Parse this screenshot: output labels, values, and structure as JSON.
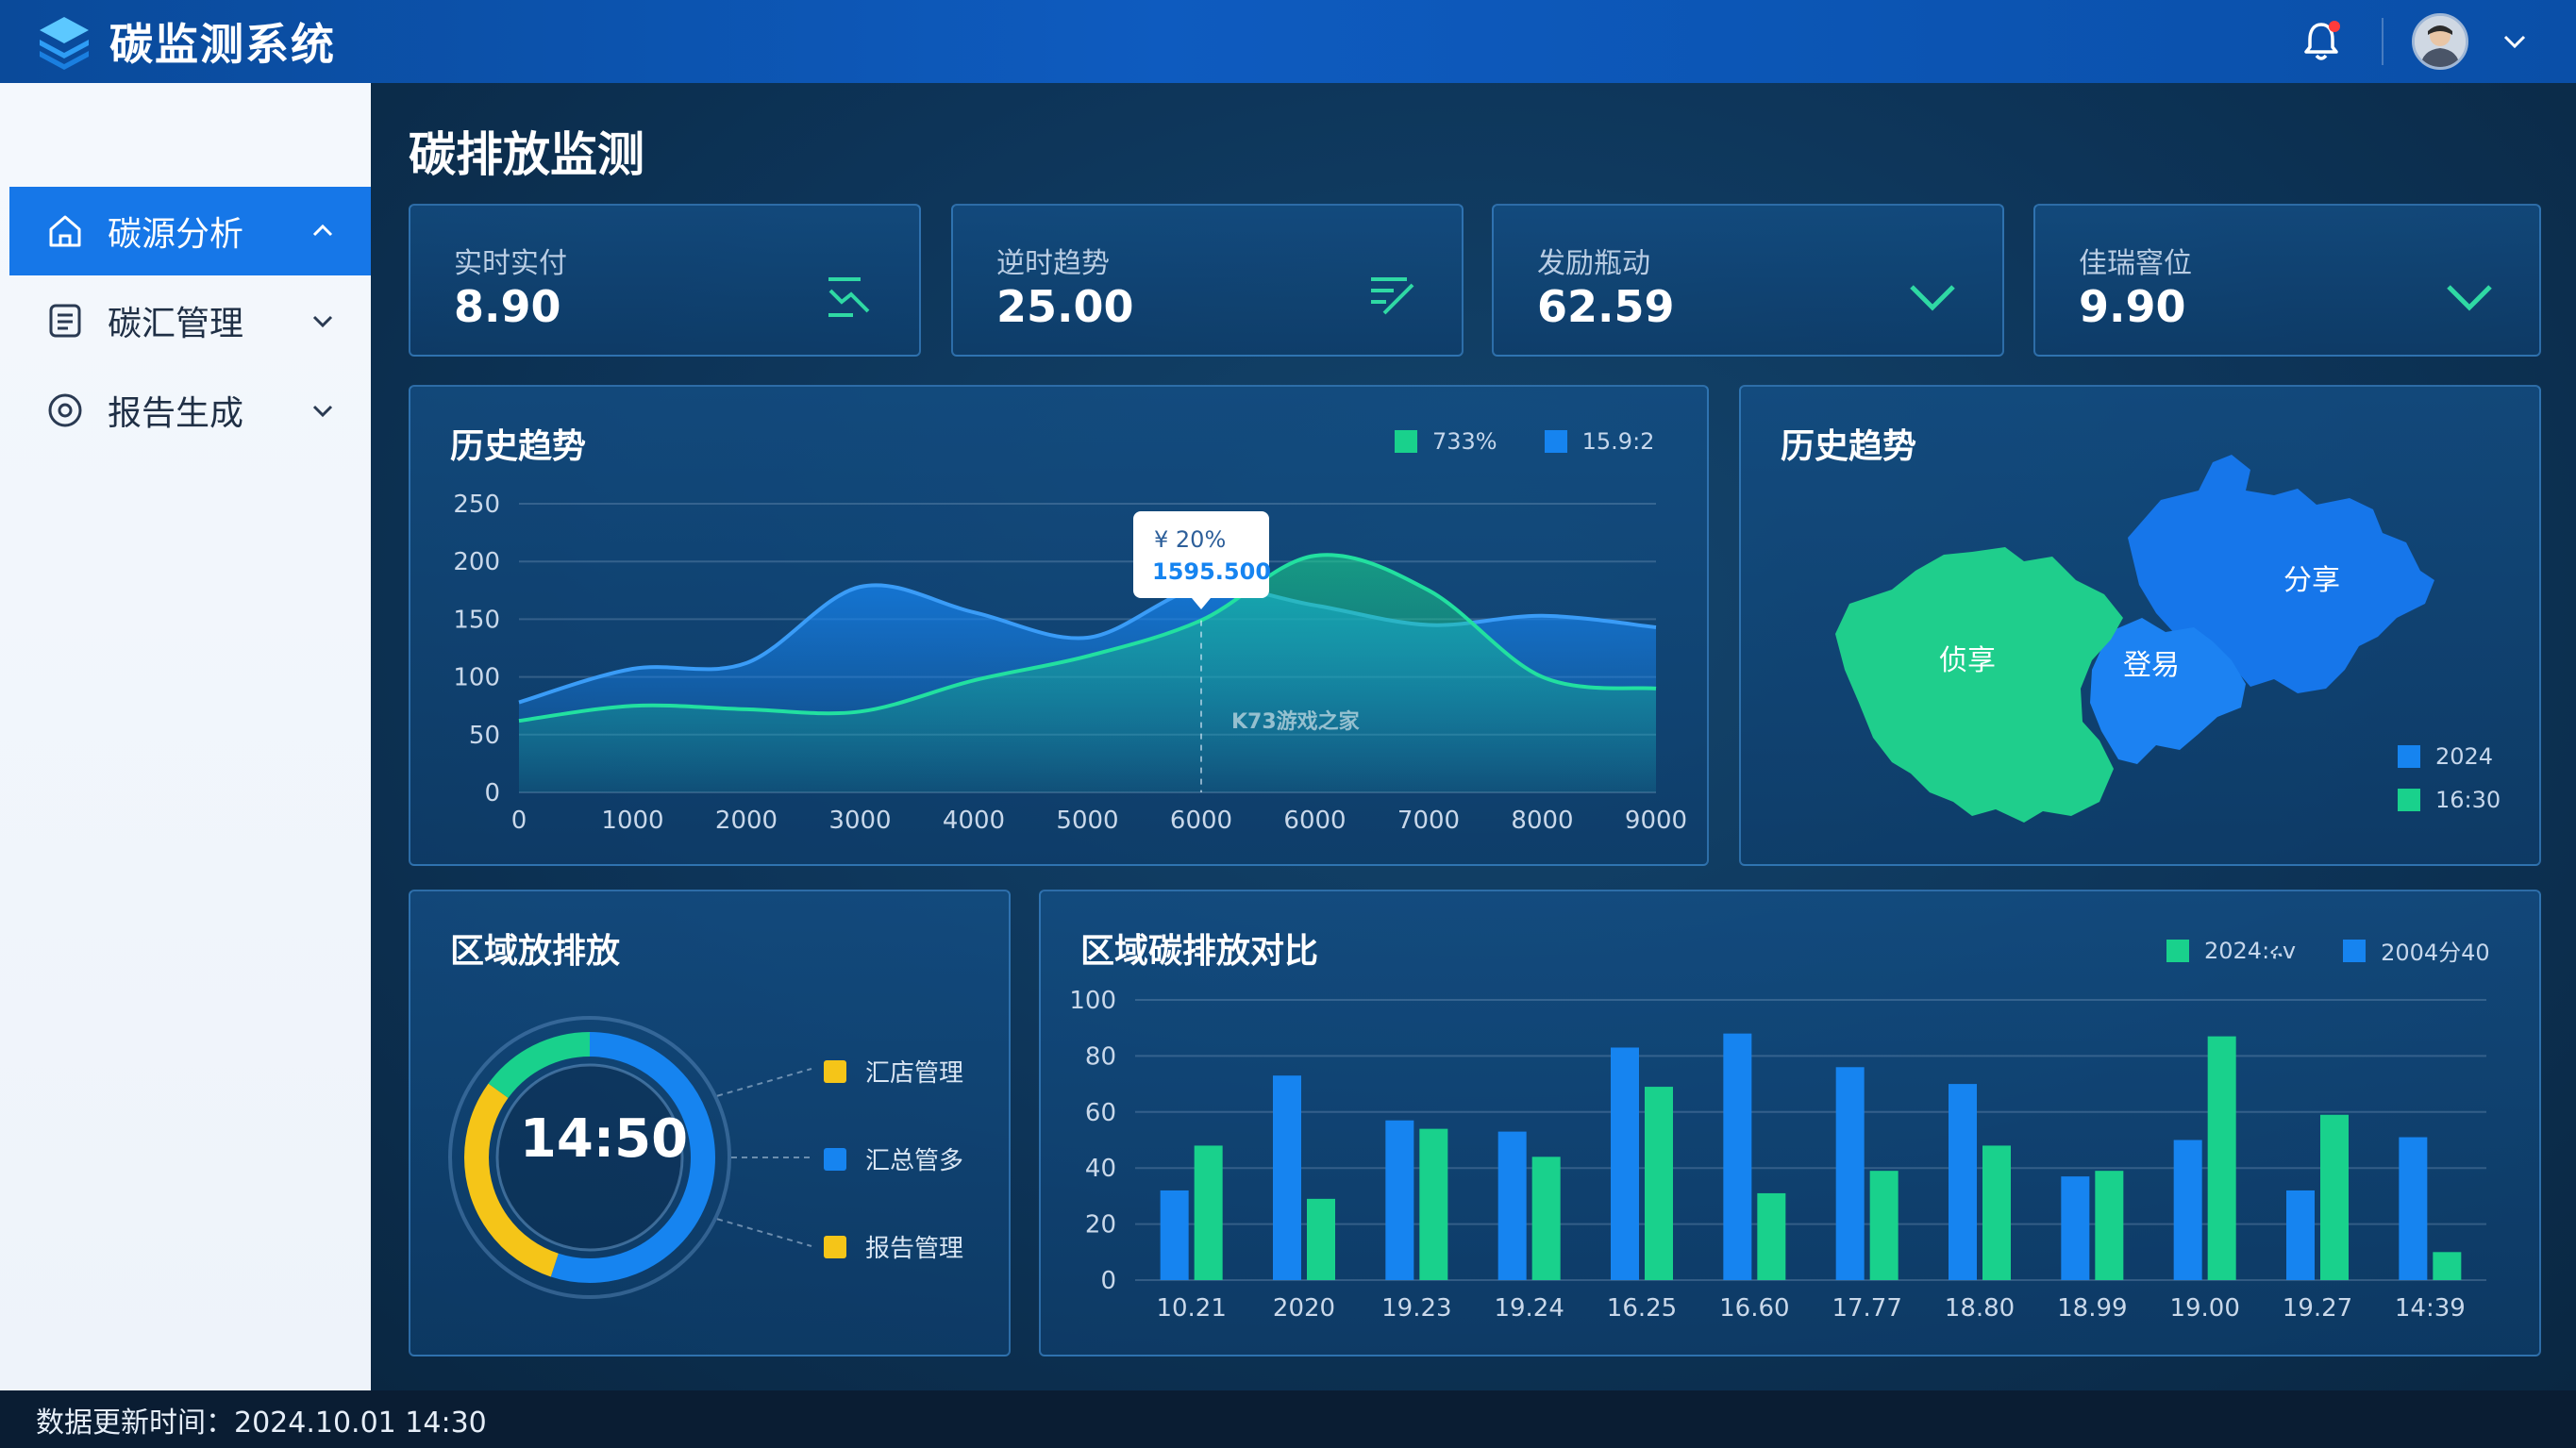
{
  "app": {
    "title": "碳监测系统"
  },
  "sidebar": {
    "items": [
      {
        "label": "碳源分析",
        "icon": "home-icon",
        "active": true,
        "chevron": "up"
      },
      {
        "label": "碳汇管理",
        "icon": "document-icon",
        "active": false,
        "chevron": "down"
      },
      {
        "label": "报告生成",
        "icon": "target-icon",
        "active": false,
        "chevron": "down"
      }
    ]
  },
  "main": {
    "title": "碳排放监测",
    "stats": [
      {
        "label": "实时实付",
        "value": "8.90",
        "icon": "trend-down-icon"
      },
      {
        "label": "逆时趋势",
        "value": "25.00",
        "icon": "trend-up-icon"
      },
      {
        "label": "发励瓶动",
        "value": "62.59",
        "icon": "chevron-down-icon"
      },
      {
        "label": "佳瑞窨位",
        "value": "9.90",
        "icon": "chevron-down-icon"
      }
    ]
  },
  "history_panel": {
    "title": "历史趋势",
    "legend": [
      {
        "label": "733%",
        "color": "#19d18c"
      },
      {
        "label": "15.9:2",
        "color": "#1684f0"
      }
    ],
    "tooltip": {
      "line1": "¥ 20%",
      "line2": "1595.500"
    },
    "watermark": "K73游戏之家"
  },
  "map_panel": {
    "title": "历史趋势",
    "regions": [
      "分享",
      "侦享",
      "登易"
    ],
    "legend": [
      {
        "label": "2024",
        "color": "#1684f0"
      },
      {
        "label": "16:30",
        "color": "#19d18c"
      }
    ]
  },
  "donut_panel": {
    "title": "区域放排放",
    "center": "14:50",
    "legend": [
      {
        "label": "汇店管理",
        "color": "#f5c518"
      },
      {
        "label": "汇总管多",
        "color": "#1684f0"
      },
      {
        "label": "报告管理",
        "color": "#f5c518"
      }
    ]
  },
  "bar_panel": {
    "title": "区域碳排放对比",
    "legend": [
      {
        "label": "2024:ሩv",
        "color": "#19d18c"
      },
      {
        "label": "2004分40",
        "color": "#1684f0"
      }
    ]
  },
  "footer": {
    "update_text": "数据更新时间：2024.10.01 14:30"
  },
  "colors": {
    "blue": "#1684f0",
    "green": "#19d18c",
    "yellow": "#f5c518",
    "header": "#0e5bbf"
  },
  "chart_data": [
    {
      "type": "area",
      "title": "历史趋势",
      "x_ticks": [
        "0",
        "1000",
        "2000",
        "3000",
        "4000",
        "5000",
        "6000",
        "6000",
        "7000",
        "8000",
        "9000"
      ],
      "y_ticks": [
        "0",
        "50",
        "100",
        "150",
        "200",
        "250"
      ],
      "ylim": [
        0,
        250
      ],
      "series": [
        {
          "name": "15.9:2",
          "color": "#1684f0",
          "values": [
            78,
            107,
            112,
            178,
            156,
            134,
            177,
            162,
            145,
            153,
            143
          ]
        },
        {
          "name": "733%",
          "color": "#19d18c",
          "values": [
            62,
            75,
            72,
            70,
            97,
            118,
            149,
            205,
            175,
            100,
            90
          ]
        }
      ]
    },
    {
      "type": "bar",
      "title": "区域碳排放对比",
      "categories": [
        "10.21",
        "2020",
        "19.23",
        "19.24",
        "16.25",
        "16.60",
        "17.77",
        "18.80",
        "18.99",
        "19.00",
        "19.27",
        "14:39"
      ],
      "y_ticks": [
        "0",
        "20",
        "40",
        "60",
        "80",
        "100"
      ],
      "ylim": [
        0,
        100
      ],
      "series": [
        {
          "name": "2004分40",
          "color": "#1684f0",
          "values": [
            32,
            73,
            57,
            53,
            83,
            88,
            76,
            70,
            37,
            50,
            32,
            51
          ]
        },
        {
          "name": "2024:ሩv",
          "color": "#19d18c",
          "values": [
            48,
            29,
            54,
            44,
            69,
            31,
            39,
            48,
            39,
            87,
            59,
            10
          ]
        }
      ]
    },
    {
      "type": "pie",
      "title": "区域放排放",
      "slices": [
        {
          "label": "汇总管多",
          "value": 55,
          "color": "#1684f0"
        },
        {
          "label": "汇店管理",
          "value": 30,
          "color": "#f5c518"
        },
        {
          "label": "报告管理",
          "value": 15,
          "color": "#19d18c"
        }
      ]
    }
  ]
}
